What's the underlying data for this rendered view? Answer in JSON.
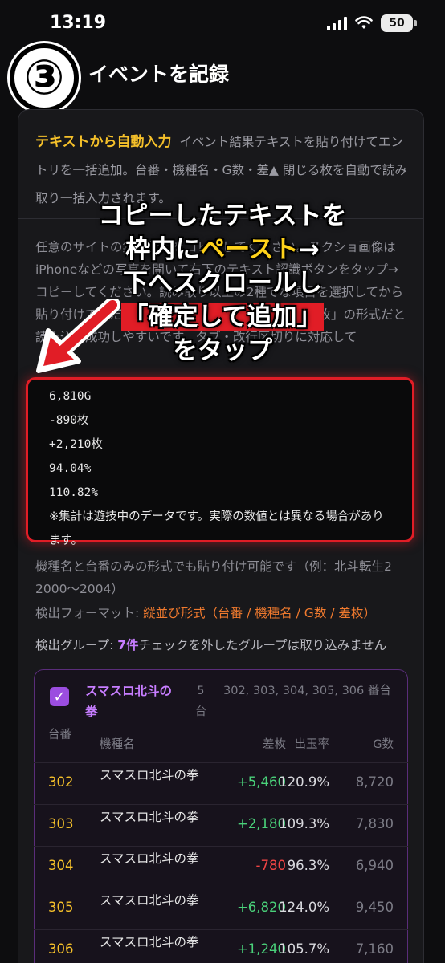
{
  "status": {
    "time": "13:19",
    "battery": "50"
  },
  "header": {
    "step": "③",
    "title": "イベントを記録"
  },
  "intro": {
    "highlight": "テキストから自動入力",
    "text": "イベント結果テキストを貼り付けてエントリを一括追加。台番・機種名・G数・差▲ 閉じる枚を自動で読み取り一括入力されます。"
  },
  "description": "任意のサイトの集計結果をコピーしてください。スクショ画像はiPhoneなどの写真を開いて右下のテキスト認識ボタンをタップ→コピーしてください。読み取り以上の2種でな項目を選択してから貼り付けてください。「台番」「機種名」「G数」「差枚」の形式だと読み込み成功しやすいです。タブ・改行区切りに対応して",
  "paste_lines": [
    "6,810G",
    "-890枚",
    "+2,210枚",
    "94.04%",
    "110.82%"
  ],
  "paste_note": "※集計は遊技中のデータです。実際の数値とは異なる場合があります。",
  "hint": "機種名と台番のみの形式でも貼り付け可能です（例：北斗転生2 2000〜2004）",
  "format": {
    "label": "検出フォーマット: ",
    "value": "縦並び形式（台番 / 機種名 / G数 / 差枚）"
  },
  "groups": {
    "label": "検出グループ: ",
    "count": "7件",
    "suffix": "チェックを外したグループは取り込みません"
  },
  "group": {
    "checkbox": "✓",
    "name": "スマスロ北斗の拳",
    "count_num": "5",
    "count_unit": "台",
    "units": "302, 303, 304, 305, 306 番台",
    "headers": {
      "unit": "台番",
      "machine": "機種名",
      "diff": "差枚",
      "rate": "出玉率",
      "games": "G数"
    },
    "rows": [
      {
        "unit": "302",
        "machine": "スマスロ北斗の拳",
        "diff": "+5,460",
        "rate": "120.9%",
        "games": "8,720"
      },
      {
        "unit": "303",
        "machine": "スマスロ北斗の拳",
        "diff": "+2,180",
        "rate": "109.3%",
        "games": "7,830"
      },
      {
        "unit": "304",
        "machine": "スマスロ北斗の拳",
        "diff": "-780",
        "rate": "96.3%",
        "games": "6,940"
      },
      {
        "unit": "305",
        "machine": "スマスロ北斗の拳",
        "diff": "+6,820",
        "rate": "124.0%",
        "games": "9,450"
      },
      {
        "unit": "306",
        "machine": "スマスロ北斗の拳",
        "diff": "+1,240",
        "rate": "105.7%",
        "games": "7,160"
      }
    ]
  },
  "overlay": {
    "line1": "コピーしたテキストを",
    "line2_prefix": "枠内に",
    "line2_highlight": "ペースト",
    "line2_suffix": "→",
    "line3": "下へスクロールし",
    "line4": "「確定して追加」",
    "line5": "をタップ"
  },
  "colors": {
    "accent_yellow": "#f5c02a",
    "accent_purple": "#c77dff",
    "highlight_red": "#e11d26",
    "positive": "#4ad17a",
    "negative": "#ef4444"
  }
}
